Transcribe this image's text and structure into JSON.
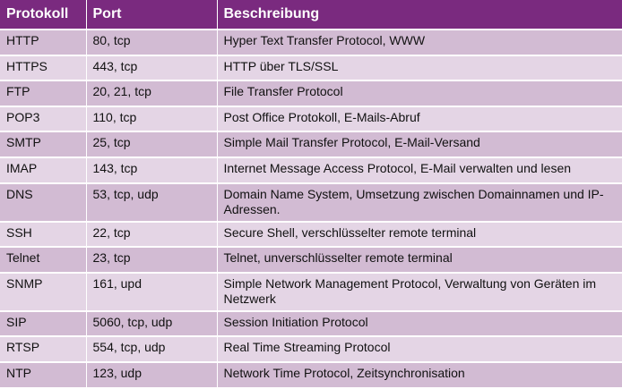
{
  "table": {
    "headers": [
      "Protokoll",
      "Port",
      "Beschreibung"
    ],
    "rows": [
      [
        "HTTP",
        "80, tcp",
        "Hyper Text Transfer Protocol, WWW"
      ],
      [
        "HTTPS",
        "443, tcp",
        "HTTP über TLS/SSL"
      ],
      [
        "FTP",
        "20, 21, tcp",
        "File Transfer Protocol"
      ],
      [
        "POP3",
        "110, tcp",
        "Post Office Protokoll, E-Mails-Abruf"
      ],
      [
        "SMTP",
        "25, tcp",
        "Simple Mail Transfer Protocol, E-Mail-Versand"
      ],
      [
        "IMAP",
        "143, tcp",
        "Internet Message Access Protocol, E-Mail verwalten und lesen"
      ],
      [
        "DNS",
        "53, tcp, udp",
        "Domain Name System, Umsetzung zwischen Domainnamen und IP-Adressen."
      ],
      [
        "SSH",
        "22, tcp",
        "Secure Shell, verschlüsselter remote terminal"
      ],
      [
        "Telnet",
        "23, tcp",
        "Telnet, unverschlüsselter remote terminal"
      ],
      [
        "SNMP",
        "161, upd",
        "Simple Network Management Protocol, Verwaltung von Geräten im Netzwerk"
      ],
      [
        "SIP",
        "5060, tcp, udp",
        "Session Initiation Protocol"
      ],
      [
        "RTSP",
        "554, tcp, udp",
        "Real Time Streaming Protocol"
      ],
      [
        "NTP",
        "123, udp",
        "Network Time Protocol, Zeitsynchronisation"
      ]
    ]
  },
  "colors": {
    "header_bg": "#7a2a7f",
    "row_light": "#e4d5e5",
    "row_dark": "#d2bbd3"
  }
}
